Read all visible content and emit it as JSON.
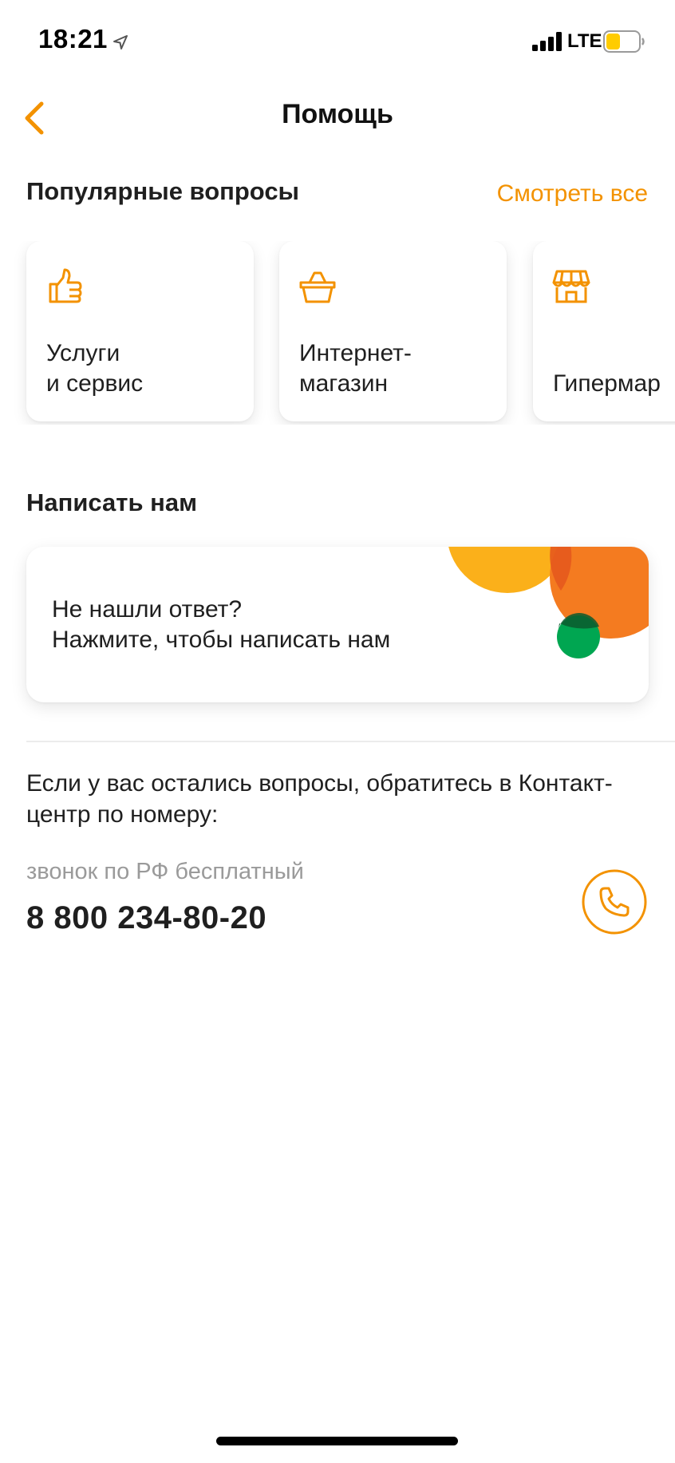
{
  "status_bar": {
    "time": "18:21",
    "network": "LTE",
    "icons": [
      "location-arrow-icon",
      "signal-bars-icon",
      "battery-icon"
    ]
  },
  "nav": {
    "back_icon": "chevron-left-icon",
    "title": "Помощь"
  },
  "popular": {
    "title": "Популярные вопросы",
    "see_all": "Смотреть все",
    "cards": [
      {
        "icon": "thumbs-up-icon",
        "label": "Услуги\nи сервис"
      },
      {
        "icon": "basket-icon",
        "label": "Интернет-\nмагазин"
      },
      {
        "icon": "store-icon",
        "label": "Гипермар"
      }
    ]
  },
  "write_us": {
    "title": "Написать нам",
    "line1": "Не нашли ответ?",
    "line2": "Нажмите, чтобы написать нам"
  },
  "contact": {
    "text": "Если у вас остались вопросы, обратитесь в Контакт-центр по номеру:",
    "note": "звонок по РФ бесплатный",
    "phone": "8 800 234-80-20",
    "call_icon": "phone-icon"
  },
  "colors": {
    "accent": "#f39200",
    "yellow": "#fbb01a",
    "orange": "#f47b20",
    "green": "#00a651"
  }
}
